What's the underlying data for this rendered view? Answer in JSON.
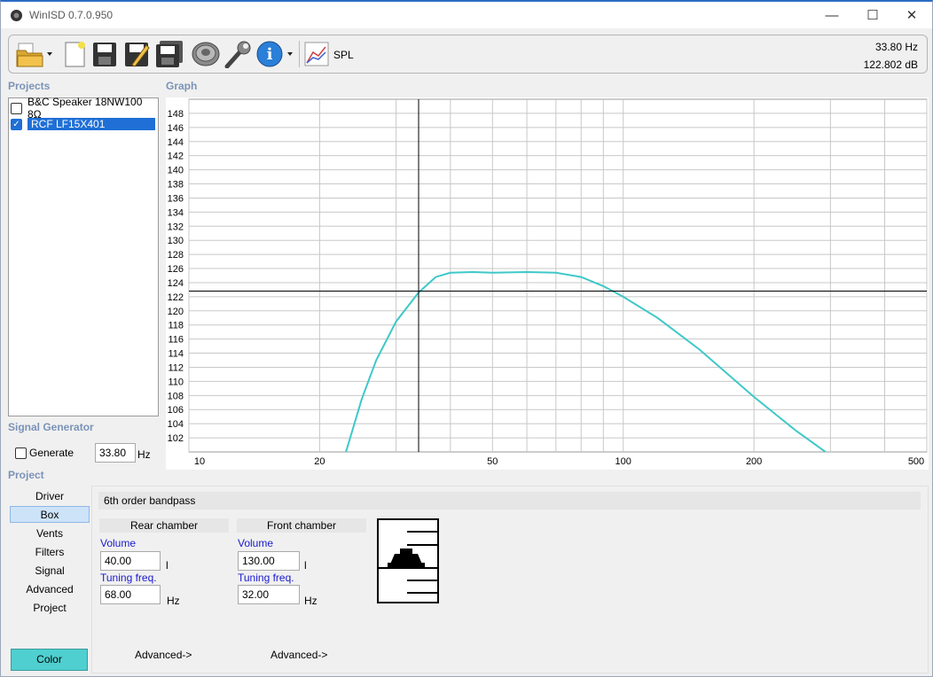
{
  "window": {
    "title": "WinISD 0.7.0.950",
    "minimize_glyph": "—",
    "maximize_glyph": "☐",
    "close_glyph": "✕"
  },
  "toolbar": {
    "spl_label": "SPL",
    "readout_freq": "33.80 Hz",
    "readout_db": "122.802 dB",
    "icons": [
      "open-folder-icon",
      "new-document-icon",
      "save-icon",
      "save-as-icon",
      "save-all-icon",
      "speaker-icon",
      "wrench-icon",
      "info-icon",
      "spl-graph-icon"
    ]
  },
  "projects": {
    "label": "Projects",
    "items": [
      {
        "label": "B&C Speaker  18NW100 8Ω",
        "checked": false,
        "selected": false
      },
      {
        "label": "RCF  LF15X401",
        "checked": true,
        "selected": true
      }
    ]
  },
  "graph": {
    "label": "Graph",
    "y_ticks": [
      "148",
      "146",
      "144",
      "142",
      "140",
      "138",
      "136",
      "134",
      "132",
      "130",
      "128",
      "126",
      "124",
      "122",
      "120",
      "118",
      "116",
      "114",
      "112",
      "110",
      "108",
      "106",
      "104",
      "102"
    ],
    "x_ticks": [
      "10",
      "20",
      "50",
      "100",
      "200",
      "500"
    ]
  },
  "chart_data": {
    "type": "line",
    "xscale": "log",
    "xlim": [
      10,
      500
    ],
    "ylim": [
      100,
      150
    ],
    "grid": true,
    "cursor": {
      "x": 33.8,
      "y": 122.802
    },
    "series": [
      {
        "color": "#3fc8c8",
        "x": [
          23,
          25,
          27,
          30,
          33.8,
          37,
          40,
          45,
          50,
          60,
          70,
          80,
          90,
          100,
          120,
          150,
          200,
          250,
          300
        ],
        "y": [
          100,
          107.5,
          113,
          118.5,
          122.6,
          124.8,
          125.4,
          125.5,
          125.4,
          125.5,
          125.4,
          124.8,
          123.5,
          122.0,
          119.0,
          114.5,
          107.8,
          103,
          99.5
        ]
      }
    ]
  },
  "signal_generator": {
    "label": "Signal Generator",
    "generate_label": "Generate",
    "generate_checked": false,
    "freq_value": "33.80",
    "freq_unit": "Hz"
  },
  "project_nav": {
    "label": "Project",
    "items": [
      "Driver",
      "Box",
      "Vents",
      "Filters",
      "Signal",
      "Advanced",
      "Project"
    ],
    "selected": "Box",
    "color_button": "Color",
    "color_button_color": "#4fcfcf"
  },
  "box_panel": {
    "header": "6th order bandpass",
    "rear": {
      "title": "Rear chamber",
      "volume_label": "Volume",
      "volume_value": "40.00",
      "volume_unit": "l",
      "tuning_label": "Tuning freq.",
      "tuning_value": "68.00",
      "tuning_unit": "Hz",
      "advanced": "Advanced->"
    },
    "front": {
      "title": "Front chamber",
      "volume_label": "Volume",
      "volume_value": "130.00",
      "volume_unit": "l",
      "tuning_label": "Tuning freq.",
      "tuning_value": "32.00",
      "tuning_unit": "Hz",
      "advanced": "Advanced->"
    }
  }
}
